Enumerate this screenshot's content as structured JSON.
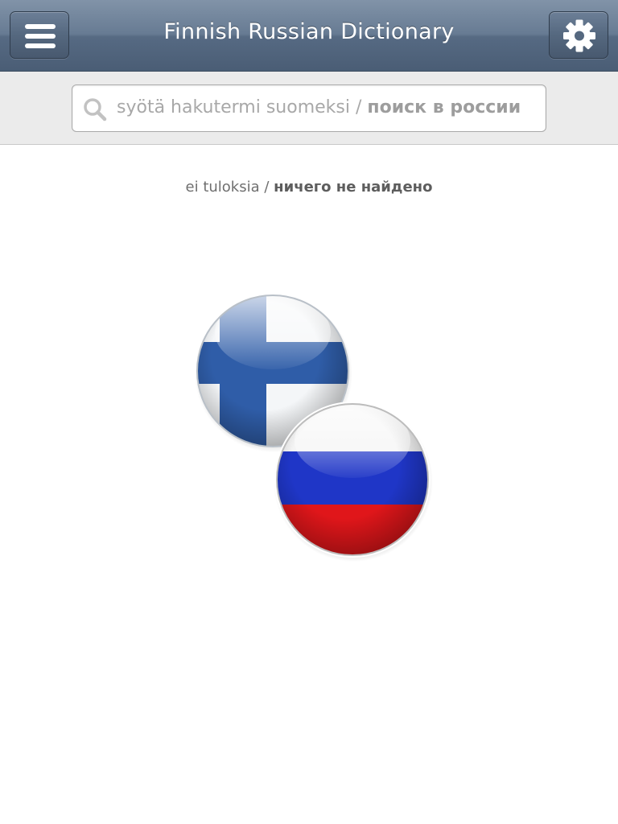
{
  "header": {
    "title": "Finnish Russian Dictionary",
    "menu_icon": "hamburger-menu-icon",
    "settings_icon": "gear-icon"
  },
  "search": {
    "placeholder_fi": "syötä hakutermi suomeksi /",
    "placeholder_ru": "поиск в россии",
    "icon": "search-icon"
  },
  "status": {
    "text_fi": "ei tuloksia /",
    "text_ru": "ничего не найдено"
  },
  "flags": {
    "finland": {
      "name_icon": "finland-flag-icon",
      "white": "#f4f6f8",
      "cross": "#2f5da8"
    },
    "russia": {
      "name_icon": "russia-flag-icon",
      "white": "#f4f4f4",
      "blue": "#1f36c7",
      "red": "#e0161a"
    }
  },
  "colors": {
    "header_top": "#8193a8",
    "header_bottom": "#4a5d75",
    "search_bg": "#ebebeb"
  }
}
